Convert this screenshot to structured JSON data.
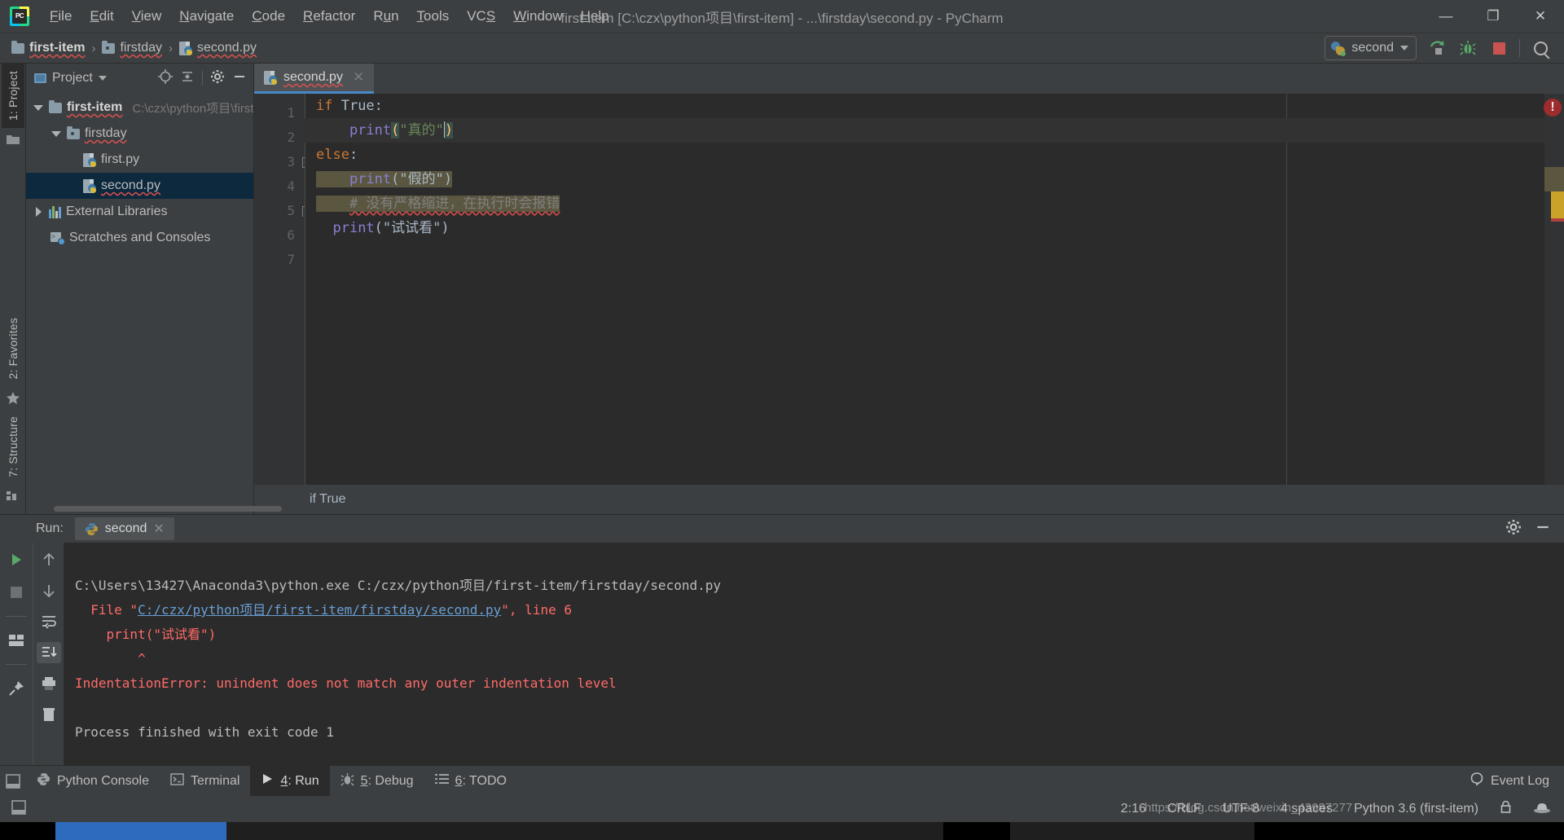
{
  "window": {
    "title": "first-item [C:\\czx\\python项目\\first-item] - ...\\firstday\\second.py - PyCharm",
    "minimize_label": "—",
    "maximize_label": "❐",
    "close_label": "✕"
  },
  "menu": [
    {
      "label": "File",
      "mnemonic": "F"
    },
    {
      "label": "Edit",
      "mnemonic": "E"
    },
    {
      "label": "View",
      "mnemonic": "V"
    },
    {
      "label": "Navigate",
      "mnemonic": "N"
    },
    {
      "label": "Code",
      "mnemonic": "C"
    },
    {
      "label": "Refactor",
      "mnemonic": "R"
    },
    {
      "label": "Run",
      "mnemonic": "u"
    },
    {
      "label": "Tools",
      "mnemonic": "T"
    },
    {
      "label": "VCS",
      "mnemonic": "S"
    },
    {
      "label": "Window",
      "mnemonic": "W"
    },
    {
      "label": "Help",
      "mnemonic": "H"
    }
  ],
  "navbar": {
    "breadcrumbs": [
      {
        "label": "first-item",
        "icon": "folder-icon"
      },
      {
        "label": "firstday",
        "icon": "folder-icon"
      },
      {
        "label": "second.py",
        "icon": "python-file-icon"
      }
    ],
    "separator": "›",
    "run_config": {
      "label": "second",
      "icon": "python-config-icon"
    },
    "buttons": [
      {
        "name": "run-button",
        "icon": "run-arrow-icon"
      },
      {
        "name": "debug-button",
        "icon": "bug-icon"
      },
      {
        "name": "stop-button",
        "icon": "stop-square-icon"
      },
      {
        "name": "search-everywhere-button",
        "icon": "search-icon"
      }
    ]
  },
  "left_rail": {
    "tabs": [
      {
        "label": "1: Project",
        "active": true
      },
      {
        "label": "2: Favorites",
        "active": false
      },
      {
        "label": "7: Structure",
        "active": false
      }
    ]
  },
  "project_panel": {
    "title": "Project",
    "tools": [
      {
        "name": "locate-icon"
      },
      {
        "name": "collapse-all-icon"
      },
      {
        "name": "settings-gear-icon"
      },
      {
        "name": "hide-panel-icon"
      }
    ],
    "tree": [
      {
        "label": "first-item",
        "path": "C:\\czx\\python项目\\first",
        "depth": 0,
        "expanded": true,
        "icon": "folder-icon",
        "selected": false,
        "bold": true
      },
      {
        "label": "firstday",
        "path": "",
        "depth": 1,
        "expanded": true,
        "icon": "folder-source-icon",
        "selected": false,
        "bold": false
      },
      {
        "label": "first.py",
        "path": "",
        "depth": 2,
        "expanded": null,
        "icon": "python-file-icon",
        "selected": false,
        "bold": false
      },
      {
        "label": "second.py",
        "path": "",
        "depth": 2,
        "expanded": null,
        "icon": "python-file-icon",
        "selected": true,
        "bold": false
      },
      {
        "label": "External Libraries",
        "path": "",
        "depth": 0,
        "expanded": false,
        "icon": "library-icon",
        "selected": false,
        "bold": false
      },
      {
        "label": "Scratches and Consoles",
        "path": "",
        "depth": 0,
        "expanded": null,
        "icon": "scratches-icon",
        "selected": false,
        "bold": false
      }
    ]
  },
  "editor": {
    "tab": {
      "label": "second.py",
      "icon": "python-file-icon",
      "close": "✕"
    },
    "gutter_lines": [
      "1",
      "2",
      "3",
      "4",
      "5",
      "6",
      "7"
    ],
    "code": {
      "line1": {
        "kw": "if",
        "val": " True:"
      },
      "line2": {
        "indent": "    ",
        "fn": "print",
        "open": "(",
        "str": "\"真的\"",
        "close": ")"
      },
      "line3": {
        "kw": "else",
        "val": ":"
      },
      "line4": {
        "indent": "    ",
        "fn": "print",
        "text": "(\"假的\")"
      },
      "line5": {
        "indent": "    ",
        "comment": "# 没有严格缩进，在执行时会报错"
      },
      "line6": {
        "indent": "  ",
        "fn": "print",
        "text": "(\"试试看\")"
      }
    },
    "breadcrumb": "if True",
    "error_badge": "!"
  },
  "run_window": {
    "label": "Run:",
    "tab": {
      "label": "second",
      "icon": "python-config-icon",
      "close": "✕"
    },
    "left_buttons": [
      {
        "name": "rerun-button",
        "icon": "run-arrow-icon"
      },
      {
        "name": "stop-button",
        "icon": "stop-square-icon"
      },
      {
        "name": "restore-layout-button",
        "icon": "layout-icon"
      },
      {
        "name": "pin-tab-button",
        "icon": "pin-icon"
      }
    ],
    "right_buttons": [
      {
        "name": "scroll-up-button",
        "icon": "arrow-up-icon"
      },
      {
        "name": "scroll-down-button",
        "icon": "arrow-down-icon"
      },
      {
        "name": "soft-wrap-button",
        "icon": "soft-wrap-icon"
      },
      {
        "name": "scroll-to-end-button",
        "icon": "scroll-end-icon"
      },
      {
        "name": "print-button",
        "icon": "printer-icon"
      },
      {
        "name": "clear-all-button",
        "icon": "trash-icon"
      }
    ],
    "header_buttons": [
      {
        "name": "settings-gear-icon"
      },
      {
        "name": "hide-panel-icon"
      }
    ],
    "console": {
      "cmd": "C:\\Users\\13427\\Anaconda3\\python.exe C:/czx/python项目/first-item/firstday/second.py",
      "file_prefix": "  File \"",
      "file_link": "C:/czx/python项目/first-item/firstday/second.py",
      "file_suffix": "\", line 6",
      "source_line": "    print(\"试试看\")",
      "caret_line": "        ^",
      "error": "IndentationError: unindent does not match any outer indentation level",
      "finished": "Process finished with exit code 1"
    }
  },
  "bottom_tabs": [
    {
      "label": "Python Console",
      "icon": "python-console-icon",
      "mnemonic": "",
      "active": false
    },
    {
      "label": "Terminal",
      "icon": "terminal-icon",
      "mnemonic": "",
      "active": false
    },
    {
      "label": "4: Run",
      "icon": "run-arrow-icon",
      "mnemonic": "4",
      "active": true
    },
    {
      "label": "5: Debug",
      "icon": "bug-icon",
      "mnemonic": "5",
      "active": false
    },
    {
      "label": "6: TODO",
      "icon": "todo-list-icon",
      "mnemonic": "6",
      "active": false
    }
  ],
  "event_log": {
    "label": "Event Log",
    "icon": "event-log-icon"
  },
  "statusbar": {
    "position": "2:16",
    "line_ending": "CRLF",
    "encoding": "UTF-8",
    "indent": "4 spaces",
    "interpreter": "Python 3.6 (first-item)",
    "lock_icon": "lock-icon",
    "notifications": "hat-icon"
  },
  "watermark": "https://blog.csdn.net/weixin_43987277",
  "colors": {
    "accent_blue": "#4a88c7",
    "selection": "#0d293e",
    "keyword": "#cc7832",
    "string": "#6a8759",
    "function": "#8a7fd4",
    "comment": "#808080",
    "error_red": "#ff6b68",
    "warn_stripe": "#5b5640",
    "editor_bg": "#2b2b2b",
    "panel_bg": "#3c3f41"
  }
}
